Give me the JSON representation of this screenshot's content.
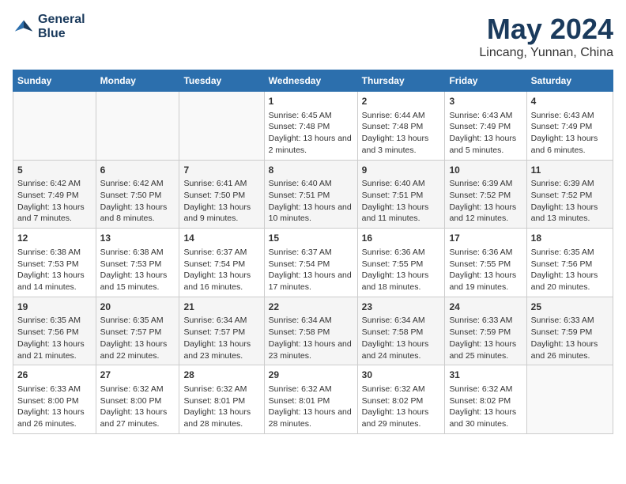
{
  "header": {
    "logo_line1": "General",
    "logo_line2": "Blue",
    "title": "May 2024",
    "subtitle": "Lincang, Yunnan, China"
  },
  "calendar": {
    "days_of_week": [
      "Sunday",
      "Monday",
      "Tuesday",
      "Wednesday",
      "Thursday",
      "Friday",
      "Saturday"
    ],
    "weeks": [
      [
        {
          "day": "",
          "info": ""
        },
        {
          "day": "",
          "info": ""
        },
        {
          "day": "",
          "info": ""
        },
        {
          "day": "1",
          "info": "Sunrise: 6:45 AM\nSunset: 7:48 PM\nDaylight: 13 hours and 2 minutes."
        },
        {
          "day": "2",
          "info": "Sunrise: 6:44 AM\nSunset: 7:48 PM\nDaylight: 13 hours and 3 minutes."
        },
        {
          "day": "3",
          "info": "Sunrise: 6:43 AM\nSunset: 7:49 PM\nDaylight: 13 hours and 5 minutes."
        },
        {
          "day": "4",
          "info": "Sunrise: 6:43 AM\nSunset: 7:49 PM\nDaylight: 13 hours and 6 minutes."
        }
      ],
      [
        {
          "day": "5",
          "info": "Sunrise: 6:42 AM\nSunset: 7:49 PM\nDaylight: 13 hours and 7 minutes."
        },
        {
          "day": "6",
          "info": "Sunrise: 6:42 AM\nSunset: 7:50 PM\nDaylight: 13 hours and 8 minutes."
        },
        {
          "day": "7",
          "info": "Sunrise: 6:41 AM\nSunset: 7:50 PM\nDaylight: 13 hours and 9 minutes."
        },
        {
          "day": "8",
          "info": "Sunrise: 6:40 AM\nSunset: 7:51 PM\nDaylight: 13 hours and 10 minutes."
        },
        {
          "day": "9",
          "info": "Sunrise: 6:40 AM\nSunset: 7:51 PM\nDaylight: 13 hours and 11 minutes."
        },
        {
          "day": "10",
          "info": "Sunrise: 6:39 AM\nSunset: 7:52 PM\nDaylight: 13 hours and 12 minutes."
        },
        {
          "day": "11",
          "info": "Sunrise: 6:39 AM\nSunset: 7:52 PM\nDaylight: 13 hours and 13 minutes."
        }
      ],
      [
        {
          "day": "12",
          "info": "Sunrise: 6:38 AM\nSunset: 7:53 PM\nDaylight: 13 hours and 14 minutes."
        },
        {
          "day": "13",
          "info": "Sunrise: 6:38 AM\nSunset: 7:53 PM\nDaylight: 13 hours and 15 minutes."
        },
        {
          "day": "14",
          "info": "Sunrise: 6:37 AM\nSunset: 7:54 PM\nDaylight: 13 hours and 16 minutes."
        },
        {
          "day": "15",
          "info": "Sunrise: 6:37 AM\nSunset: 7:54 PM\nDaylight: 13 hours and 17 minutes."
        },
        {
          "day": "16",
          "info": "Sunrise: 6:36 AM\nSunset: 7:55 PM\nDaylight: 13 hours and 18 minutes."
        },
        {
          "day": "17",
          "info": "Sunrise: 6:36 AM\nSunset: 7:55 PM\nDaylight: 13 hours and 19 minutes."
        },
        {
          "day": "18",
          "info": "Sunrise: 6:35 AM\nSunset: 7:56 PM\nDaylight: 13 hours and 20 minutes."
        }
      ],
      [
        {
          "day": "19",
          "info": "Sunrise: 6:35 AM\nSunset: 7:56 PM\nDaylight: 13 hours and 21 minutes."
        },
        {
          "day": "20",
          "info": "Sunrise: 6:35 AM\nSunset: 7:57 PM\nDaylight: 13 hours and 22 minutes."
        },
        {
          "day": "21",
          "info": "Sunrise: 6:34 AM\nSunset: 7:57 PM\nDaylight: 13 hours and 23 minutes."
        },
        {
          "day": "22",
          "info": "Sunrise: 6:34 AM\nSunset: 7:58 PM\nDaylight: 13 hours and 23 minutes."
        },
        {
          "day": "23",
          "info": "Sunrise: 6:34 AM\nSunset: 7:58 PM\nDaylight: 13 hours and 24 minutes."
        },
        {
          "day": "24",
          "info": "Sunrise: 6:33 AM\nSunset: 7:59 PM\nDaylight: 13 hours and 25 minutes."
        },
        {
          "day": "25",
          "info": "Sunrise: 6:33 AM\nSunset: 7:59 PM\nDaylight: 13 hours and 26 minutes."
        }
      ],
      [
        {
          "day": "26",
          "info": "Sunrise: 6:33 AM\nSunset: 8:00 PM\nDaylight: 13 hours and 26 minutes."
        },
        {
          "day": "27",
          "info": "Sunrise: 6:32 AM\nSunset: 8:00 PM\nDaylight: 13 hours and 27 minutes."
        },
        {
          "day": "28",
          "info": "Sunrise: 6:32 AM\nSunset: 8:01 PM\nDaylight: 13 hours and 28 minutes."
        },
        {
          "day": "29",
          "info": "Sunrise: 6:32 AM\nSunset: 8:01 PM\nDaylight: 13 hours and 28 minutes."
        },
        {
          "day": "30",
          "info": "Sunrise: 6:32 AM\nSunset: 8:02 PM\nDaylight: 13 hours and 29 minutes."
        },
        {
          "day": "31",
          "info": "Sunrise: 6:32 AM\nSunset: 8:02 PM\nDaylight: 13 hours and 30 minutes."
        },
        {
          "day": "",
          "info": ""
        }
      ]
    ]
  }
}
